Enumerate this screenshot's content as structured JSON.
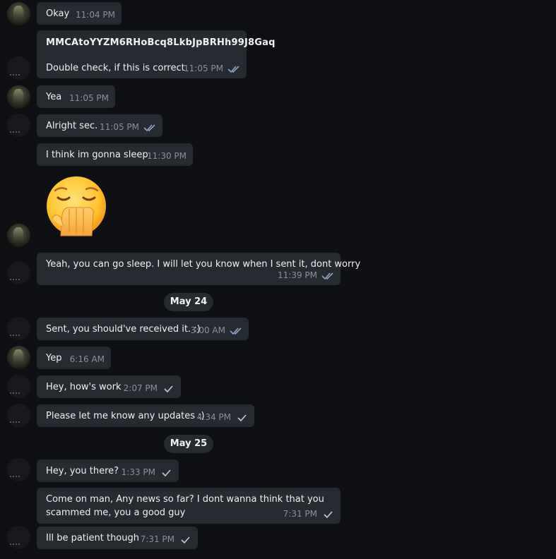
{
  "messages": [
    {
      "id": "m1",
      "text": "Okay",
      "time": "11:04 PM",
      "ticks": "none"
    },
    {
      "id": "m2",
      "text": "MMCAtoYYZM6RHoBcq8LkbJpBRHh99J8Gaq",
      "text2": "Double check, if this is correct",
      "time": "11:05 PM",
      "ticks": "double"
    },
    {
      "id": "m3",
      "text": "Yea",
      "time": "11:05 PM",
      "ticks": "none"
    },
    {
      "id": "m4",
      "text": "Alright sec.",
      "time": "11:05 PM",
      "ticks": "double"
    },
    {
      "id": "m5",
      "text": "I think im gonna sleep",
      "time": "11:30 PM",
      "ticks": "none"
    },
    {
      "id": "m6",
      "emoji": "yawning-face"
    },
    {
      "id": "m7",
      "text": "Yeah, you can go sleep. I will let you know when I sent it, dont worry",
      "time": "11:39 PM",
      "ticks": "double"
    },
    {
      "id": "m8",
      "text": "Sent, you should've received it. :)",
      "time": "3:00 AM",
      "ticks": "double"
    },
    {
      "id": "m9",
      "text": "Yep",
      "time": "6:16 AM",
      "ticks": "none"
    },
    {
      "id": "m10",
      "text": "Hey, how's work",
      "time": "2:07 PM",
      "ticks": "single"
    },
    {
      "id": "m11",
      "text": "Please let me know any updates :)",
      "time": "4:34 PM",
      "ticks": "single"
    },
    {
      "id": "m12",
      "text": "Hey, you there?",
      "time": "1:33 PM",
      "ticks": "single"
    },
    {
      "id": "m13",
      "text": "Come on man, Any news so far? I dont wanna think that you",
      "text2": "scammed me, you a good guy",
      "time": "7:31 PM",
      "ticks": "single"
    },
    {
      "id": "m14",
      "text": "Ill be patient though",
      "time": "7:31 PM",
      "ticks": "single"
    }
  ],
  "dates": {
    "d1": "May 24",
    "d2": "May 25"
  },
  "colors": {
    "background": "#0e1014",
    "bubble": "#262a31",
    "time": "#8a909a",
    "check": "#8fa6c4"
  }
}
